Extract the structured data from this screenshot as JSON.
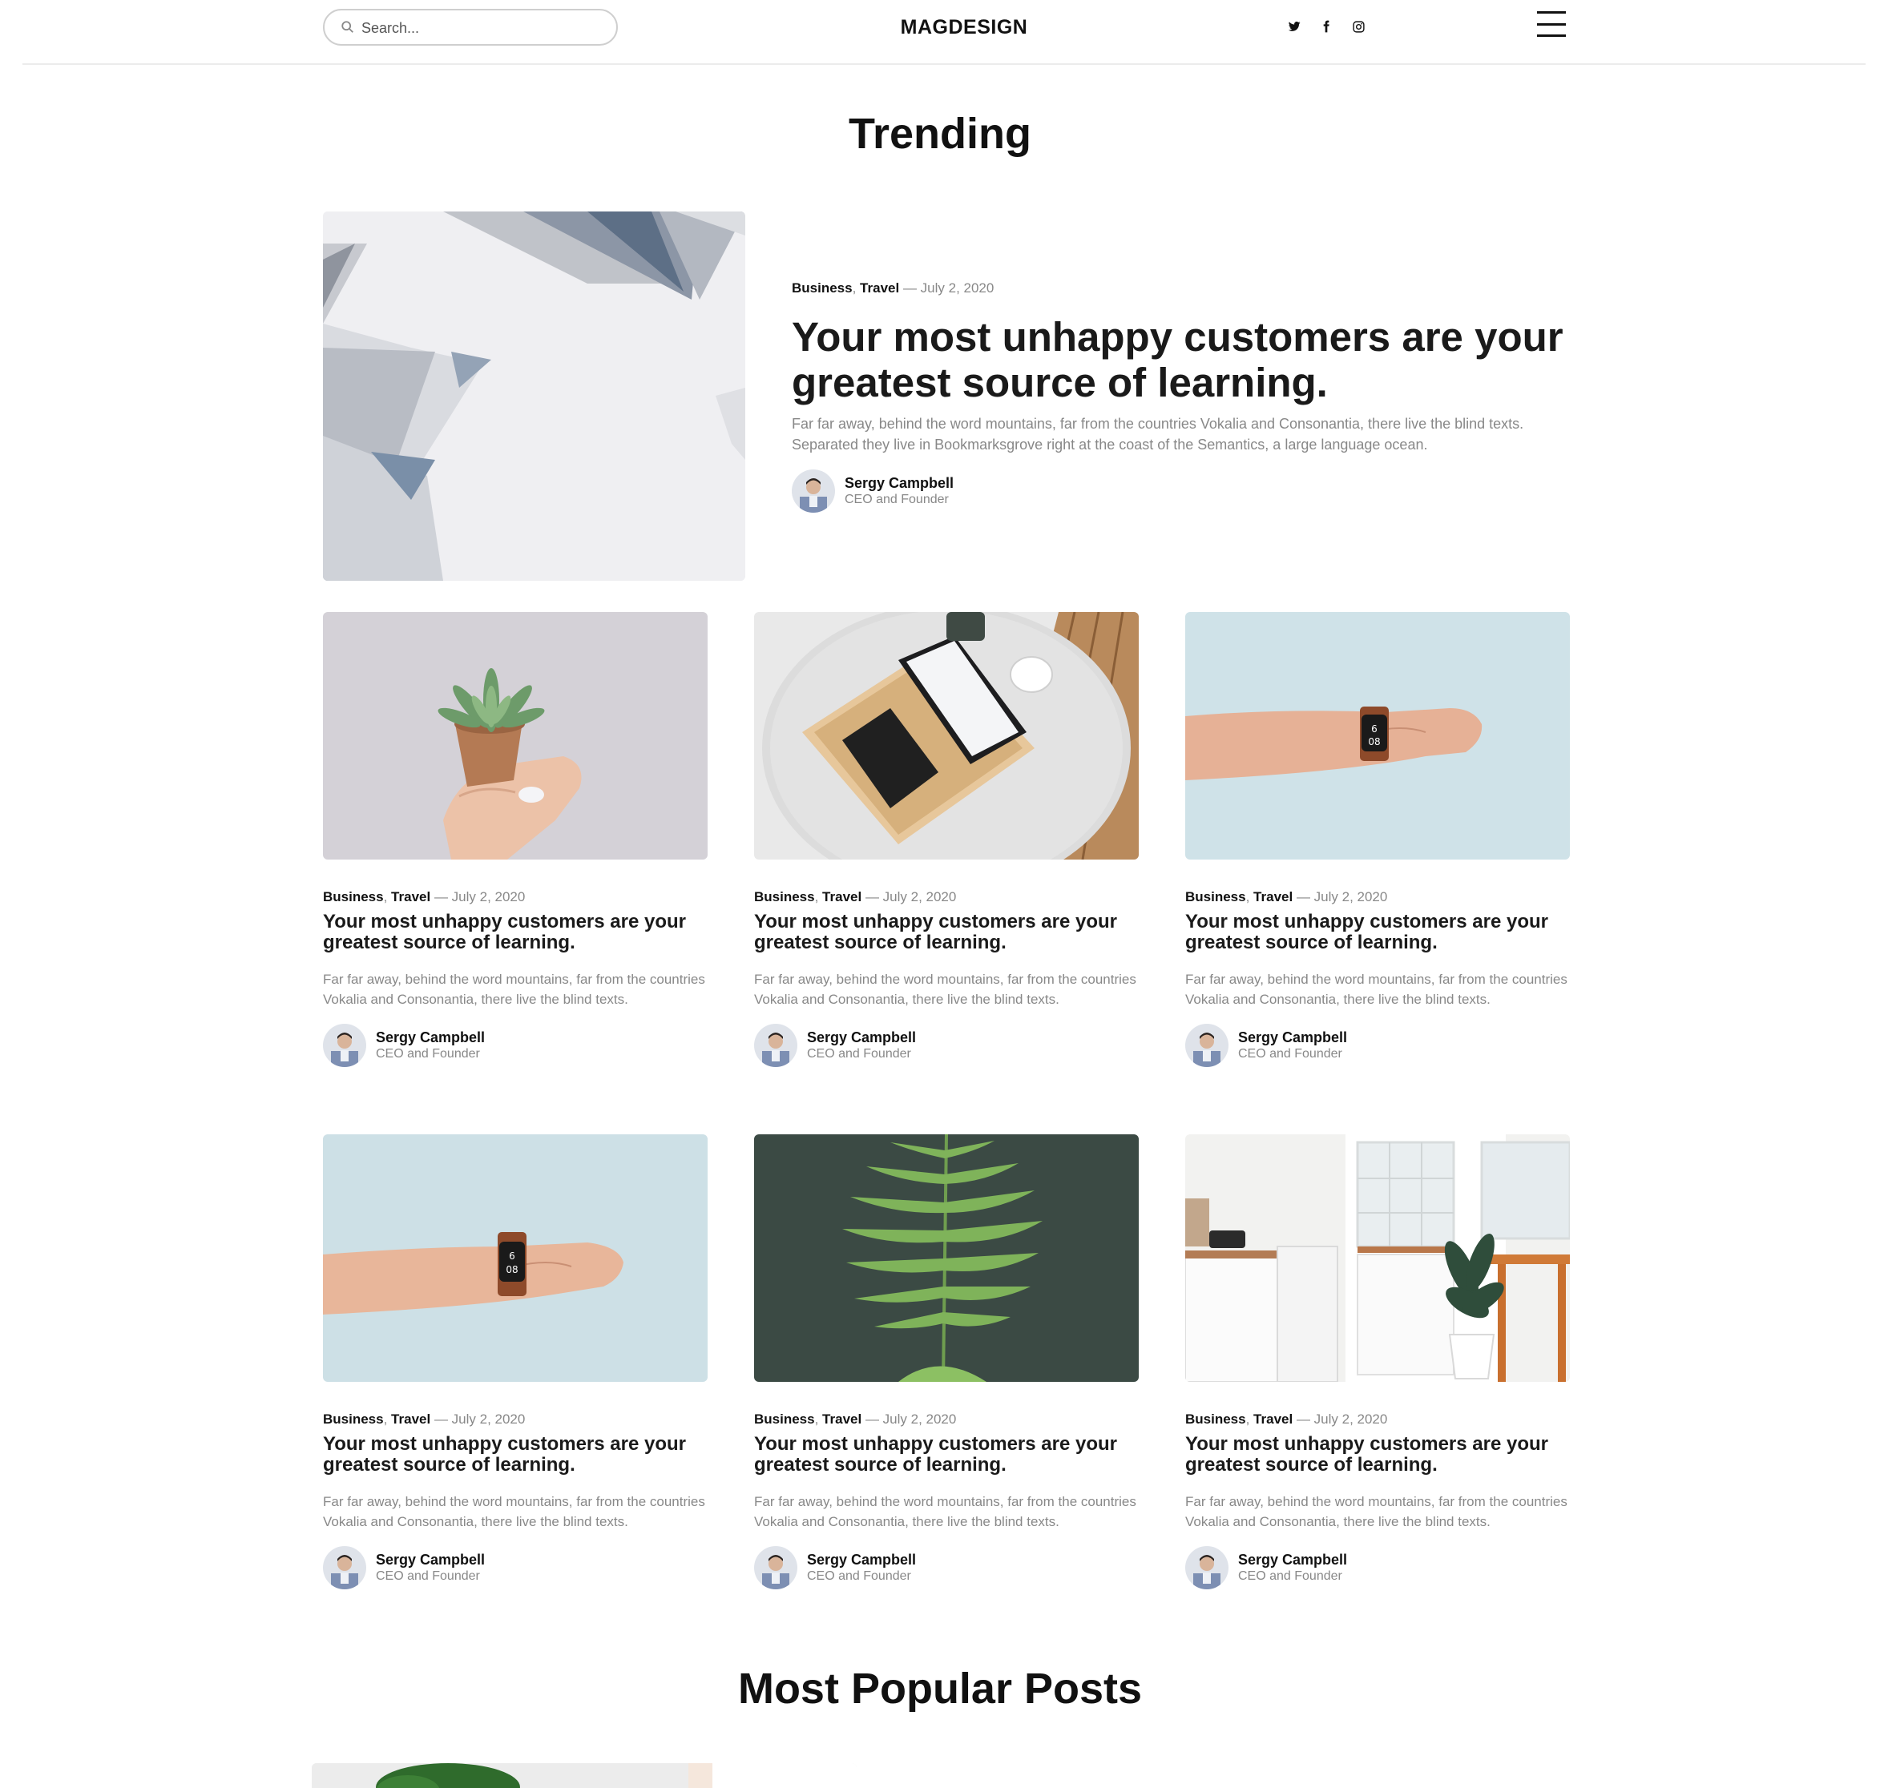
{
  "header": {
    "search_placeholder": "Search...",
    "logo": "MAGDESIGN",
    "social": [
      "twitter-icon",
      "facebook-icon",
      "instagram-icon"
    ]
  },
  "sections": {
    "trending": "Trending",
    "popular": "Most Popular Posts"
  },
  "featured": {
    "cat1": "Business",
    "cat2": "Travel",
    "date": "— July 2, 2020",
    "title": "Your most unhappy customers are your greatest source of learning.",
    "excerpt": "Far far away, behind the word mountains, far from the countries Vokalia and Consonantia, there live the blind texts. Separated they live in Bookmarksgrove right at the coast of the Semantics, a large language ocean.",
    "author_name": "Sergy Campbell",
    "author_role": "CEO and Founder"
  },
  "cards": [
    {
      "cat1": "Business",
      "cat2": "Travel",
      "date": "— July 2, 2020",
      "title": "Your most unhappy customers are your greatest source of learning.",
      "excerpt": "Far far away, behind the word mountains, far from the countries Vokalia and Consonantia, there live the blind texts.",
      "author_name": "Sergy Campbell",
      "author_role": "CEO and Founder"
    },
    {
      "cat1": "Business",
      "cat2": "Travel",
      "date": "— July 2, 2020",
      "title": "Your most unhappy customers are your greatest source of learning.",
      "excerpt": "Far far away, behind the word mountains, far from the countries Vokalia and Consonantia, there live the blind texts.",
      "author_name": "Sergy Campbell",
      "author_role": "CEO and Founder"
    },
    {
      "cat1": "Business",
      "cat2": "Travel",
      "date": "— July 2, 2020",
      "title": "Your most unhappy customers are your greatest source of learning.",
      "excerpt": "Far far away, behind the word mountains, far from the countries Vokalia and Consonantia, there live the blind texts.",
      "author_name": "Sergy Campbell",
      "author_role": "CEO and Founder"
    },
    {
      "cat1": "Business",
      "cat2": "Travel",
      "date": "— July 2, 2020",
      "title": "Your most unhappy customers are your greatest source of learning.",
      "excerpt": "Far far away, behind the word mountains, far from the countries Vokalia and Consonantia, there live the blind texts.",
      "author_name": "Sergy Campbell",
      "author_role": "CEO and Founder"
    },
    {
      "cat1": "Business",
      "cat2": "Travel",
      "date": "— July 2, 2020",
      "title": "Your most unhappy customers are your greatest source of learning.",
      "excerpt": "Far far away, behind the word mountains, far from the countries Vokalia and Consonantia, there live the blind texts.",
      "author_name": "Sergy Campbell",
      "author_role": "CEO and Founder"
    },
    {
      "cat1": "Business",
      "cat2": "Travel",
      "date": "— July 2, 2020",
      "title": "Your most unhappy customers are your greatest source of learning.",
      "excerpt": "Far far away, behind the word mountains, far from the countries Vokalia and Consonantia, there live the blind texts.",
      "author_name": "Sergy Campbell",
      "author_role": "CEO and Founder"
    }
  ],
  "colors": {
    "text": "#111111",
    "muted": "#888888",
    "border": "#cfcfcf",
    "fern_bg": "#3b4a44"
  }
}
